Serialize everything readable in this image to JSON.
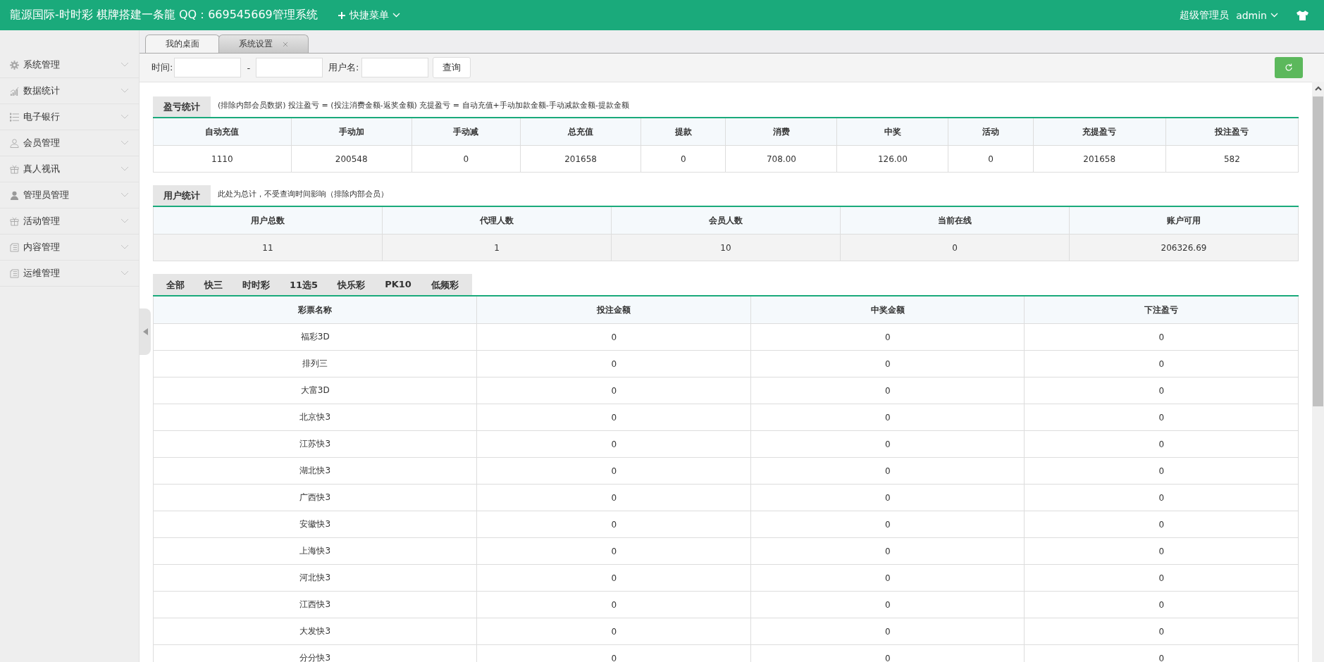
{
  "header": {
    "title": "龍源国际-时时彩 棋牌搭建一条龍 QQ：669545669管理系统",
    "quick_menu": "快捷菜单",
    "role": "超级管理员",
    "user": "admin"
  },
  "sidebar": {
    "items": [
      {
        "label": "系统管理",
        "kind": "gear",
        "expanded": false
      },
      {
        "label": "数据统计",
        "kind": "chart",
        "expanded": false
      },
      {
        "label": "电子银行",
        "kind": "list",
        "expanded": false
      },
      {
        "label": "会员管理",
        "kind": "person-outline",
        "expanded": false
      },
      {
        "label": "真人视讯",
        "kind": "gift",
        "expanded": false
      },
      {
        "label": "管理员管理",
        "kind": "person",
        "expanded": false
      },
      {
        "label": "活动管理",
        "kind": "gift",
        "expanded": false
      },
      {
        "label": "内容管理",
        "kind": "doc",
        "expanded": false
      },
      {
        "label": "运维管理",
        "kind": "doc",
        "expanded": false
      }
    ]
  },
  "tabs": [
    {
      "label": "我的桌面",
      "selected": true,
      "closable": false
    },
    {
      "label": "系统设置",
      "selected": false,
      "closable": true
    }
  ],
  "filter": {
    "time_label": "时间:",
    "separator": "-",
    "user_label": "用户名:",
    "button": "查询"
  },
  "profit": {
    "title": "盈亏统计",
    "note": "(排除内部会员数据)  投注盈亏 = (投注消费金额-返奖金额)    充提盈亏 = 自动充值+手动加款金额-手动减款金额-提款金额",
    "columns": [
      "自动充值",
      "手动加",
      "手动减",
      "总充值",
      "提款",
      "消费",
      "中奖",
      "活动",
      "充提盈亏",
      "投注盈亏"
    ],
    "rows": [
      [
        "1110",
        "200548",
        "0",
        "201658",
        "0",
        "708.00",
        "126.00",
        "0",
        "201658",
        "582"
      ]
    ]
  },
  "users": {
    "title": "用户统计",
    "note": "此处为总计，不受查询时间影响（排除内部会员）",
    "columns": [
      "用户总数",
      "代理人数",
      "会员人数",
      "当前在线",
      "账户可用"
    ],
    "rows": [
      [
        "11",
        "1",
        "10",
        "0",
        "206326.69"
      ]
    ]
  },
  "lottery": {
    "tabs": [
      {
        "label": "全部",
        "selected": false
      },
      {
        "label": "快三",
        "selected": false
      },
      {
        "label": "时时彩",
        "selected": false
      },
      {
        "label": "11选5",
        "selected": false
      },
      {
        "label": "快乐彩",
        "selected": false
      },
      {
        "label": "PK10",
        "selected": false
      },
      {
        "label": "低频彩",
        "selected": false
      }
    ],
    "columns": [
      "彩票名称",
      "投注金额",
      "中奖金额",
      "下注盈亏"
    ],
    "rows": [
      [
        "福彩3D",
        "0",
        "0",
        "0"
      ],
      [
        "排列三",
        "0",
        "0",
        "0"
      ],
      [
        "大富3D",
        "0",
        "0",
        "0"
      ],
      [
        "北京快3",
        "0",
        "0",
        "0"
      ],
      [
        "江苏快3",
        "0",
        "0",
        "0"
      ],
      [
        "湖北快3",
        "0",
        "0",
        "0"
      ],
      [
        "广西快3",
        "0",
        "0",
        "0"
      ],
      [
        "安徽快3",
        "0",
        "0",
        "0"
      ],
      [
        "上海快3",
        "0",
        "0",
        "0"
      ],
      [
        "河北快3",
        "0",
        "0",
        "0"
      ],
      [
        "江西快3",
        "0",
        "0",
        "0"
      ],
      [
        "大发快3",
        "0",
        "0",
        "0"
      ],
      [
        "分分快3",
        "0",
        "0",
        "0"
      ]
    ]
  }
}
